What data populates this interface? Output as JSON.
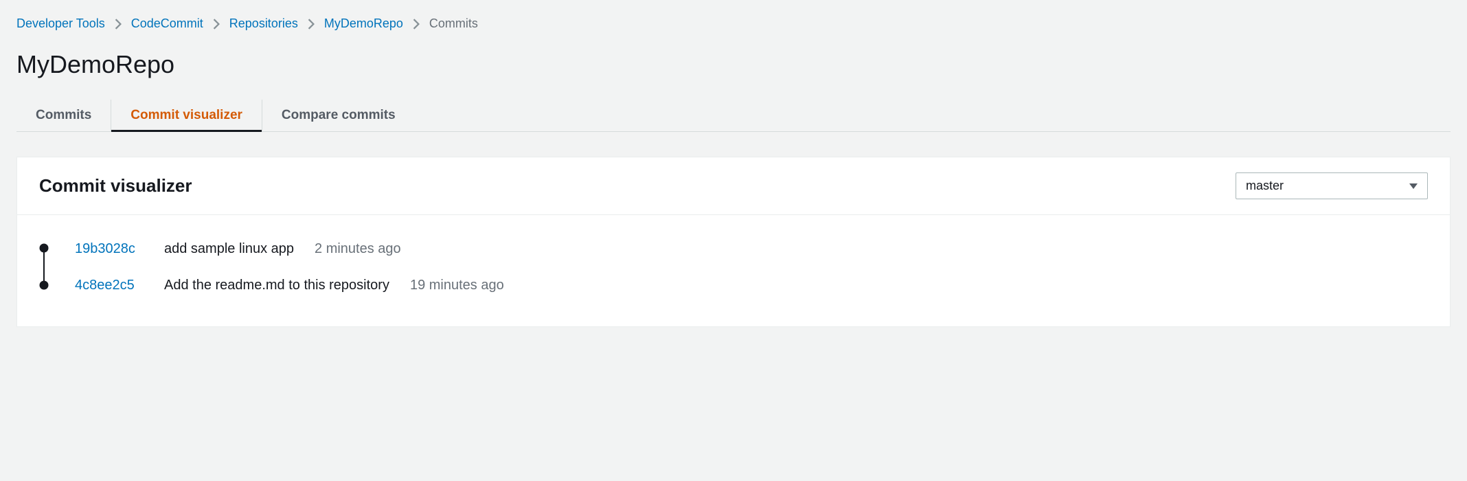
{
  "breadcrumb": {
    "items": [
      {
        "label": "Developer Tools",
        "link": true
      },
      {
        "label": "CodeCommit",
        "link": true
      },
      {
        "label": "Repositories",
        "link": true
      },
      {
        "label": "MyDemoRepo",
        "link": true
      },
      {
        "label": "Commits",
        "link": false
      }
    ]
  },
  "page_title": "MyDemoRepo",
  "tabs": {
    "commits": "Commits",
    "visualizer": "Commit visualizer",
    "compare": "Compare commits"
  },
  "panel": {
    "title": "Commit visualizer",
    "branch": "master"
  },
  "commits": [
    {
      "hash": "19b3028c",
      "message": "add sample linux app",
      "time": "2 minutes ago"
    },
    {
      "hash": "4c8ee2c5",
      "message": "Add the readme.md to this repository",
      "time": "19 minutes ago"
    }
  ]
}
